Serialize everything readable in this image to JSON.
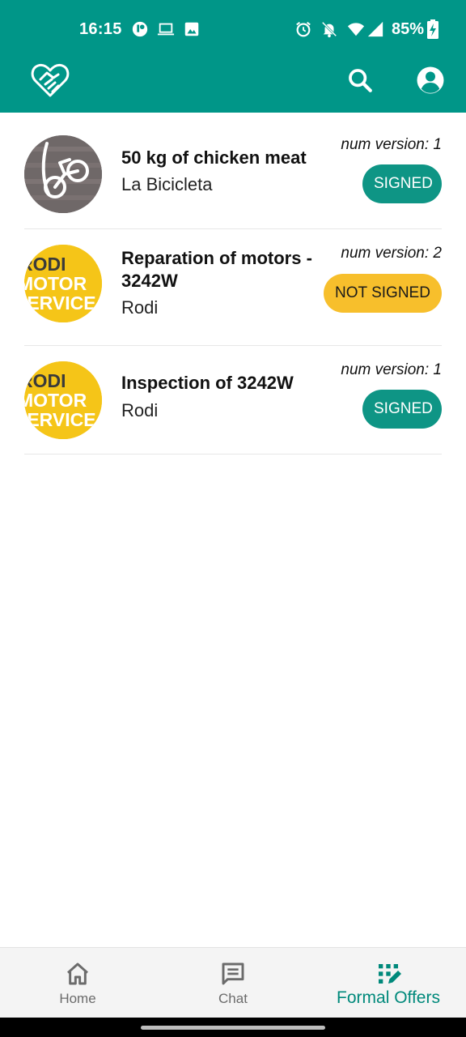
{
  "status_bar": {
    "time": "16:15",
    "battery": "85%",
    "icons": [
      "app-notification-icon",
      "laptop-icon",
      "image-icon",
      "alarm-icon",
      "bell-off-icon",
      "wifi-icon",
      "signal-icon",
      "battery-charging-icon"
    ]
  },
  "app_bar": {
    "logo_icon": "heart-handshake-icon",
    "actions": [
      "search-icon",
      "account-circle-icon"
    ],
    "color": "#009688"
  },
  "offers": [
    {
      "title": "50 kg of chicken meat",
      "company": "La Bicicleta",
      "version": "num version: 1",
      "status": "SIGNED",
      "avatar": "la-bicicleta-logo"
    },
    {
      "title_line1": "Reparation of motors -",
      "title_line2": "3242W",
      "company": "Rodi",
      "version": "num version: 2",
      "status": "NOT SIGNED",
      "avatar": "rodi-motor-service-logo"
    },
    {
      "title": "Inspection of 3242W",
      "company": "Rodi",
      "version": "num version: 1",
      "status": "SIGNED",
      "avatar": "rodi-motor-service-logo"
    }
  ],
  "logos": {
    "rodi": {
      "line1": "RODI",
      "line2": "MOTOR",
      "line3": "SERVICE"
    }
  },
  "status_colors": {
    "signed": "#0e9585",
    "not_signed": "#f7bf2c"
  },
  "bottom_nav": {
    "items": [
      {
        "label": "Home",
        "icon": "home-icon",
        "active": false
      },
      {
        "label": "Chat",
        "icon": "chat-icon",
        "active": false
      },
      {
        "label": "Formal Offers",
        "icon": "formal-offers-icon",
        "active": true
      }
    ],
    "active_color": "#00897b"
  }
}
